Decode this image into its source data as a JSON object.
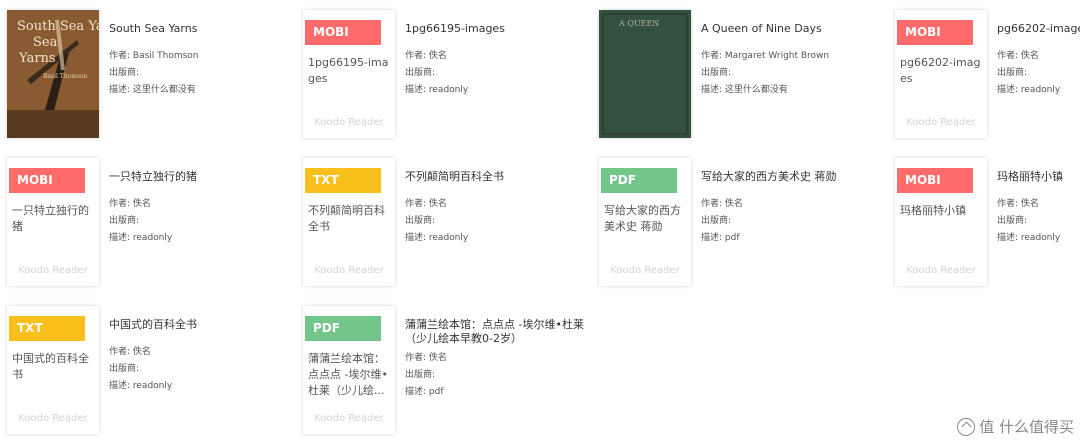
{
  "colors": {
    "mobi": "#ff6b6b",
    "txt": "#f9bf1b",
    "pdf": "#73c58a"
  },
  "books": [
    {
      "title": "South Sea Yarns",
      "author": "作者: Basil Thomson",
      "publisher": "出版商:",
      "desc": "描述: 这里什么都没有",
      "cover_icon": "photo-cover-south-sea-yarns",
      "cover_text": "South Sea Yarns",
      "cover_sub": "Basil Thomson"
    },
    {
      "title": "1pg66195-images",
      "author": "作者: 佚名",
      "publisher": "出版商:",
      "desc": "描述: readonly",
      "tag": "MOBI",
      "cover_name": "1pg66195-images",
      "brand": "Koodo Reader"
    },
    {
      "title": "A Queen of Nine Days",
      "author": "作者: Margaret Wright Brown",
      "publisher": "出版商:",
      "desc": "描述: 这里什么都没有",
      "cover_icon": "photo-cover-queen",
      "cover_text": "A QUEEN"
    },
    {
      "title": "pg66202-images",
      "author": "作者: 佚名",
      "publisher": "出版商:",
      "desc": "描述: readonly",
      "tag": "MOBI",
      "cover_name": "pg66202-images",
      "brand": "Koodo Reader"
    },
    {
      "title": "一只特立独行的猪",
      "author": "作者: 佚名",
      "publisher": "出版商:",
      "desc": "描述: readonly",
      "tag": "MOBI",
      "cover_name": "一只特立独行的猪",
      "brand": "Koodo Reader"
    },
    {
      "title": "不列颠简明百科全书",
      "author": "作者: 佚名",
      "publisher": "出版商:",
      "desc": "描述: readonly",
      "tag": "TXT",
      "cover_name": "不列颠简明百科全书",
      "brand": "Koodo Reader"
    },
    {
      "title": "写给大家的西方美术史 蒋勋",
      "author": "作者: 佚名",
      "publisher": "出版商:",
      "desc": "描述: pdf",
      "tag": "PDF",
      "cover_name": "写给大家的西方美术史 蒋勋",
      "brand": "Koodo Reader"
    },
    {
      "title": "玛格丽特小镇",
      "author": "作者: 佚名",
      "publisher": "出版商:",
      "desc": "描述: readonly",
      "tag": "MOBI",
      "cover_name": "玛格丽特小镇",
      "brand": "Koodo Reader"
    },
    {
      "title": "中国式的百科全书",
      "author": "作者: 佚名",
      "publisher": "出版商:",
      "desc": "描述: readonly",
      "tag": "TXT",
      "cover_name": "中国式的百科全书",
      "brand": "Koodo Reader"
    },
    {
      "title": "蒲蒲兰绘本馆：点点点 -埃尔维•杜莱（少儿绘本早教0-2岁）",
      "author": "作者: 佚名",
      "publisher": "出版商:",
      "desc": "描述: pdf",
      "tag": "PDF",
      "cover_name": "蒲蒲兰绘本馆：点点点 -埃尔维•杜莱（少儿绘...",
      "brand": "Koodo Reader"
    }
  ],
  "watermark": "值 什么值得买"
}
